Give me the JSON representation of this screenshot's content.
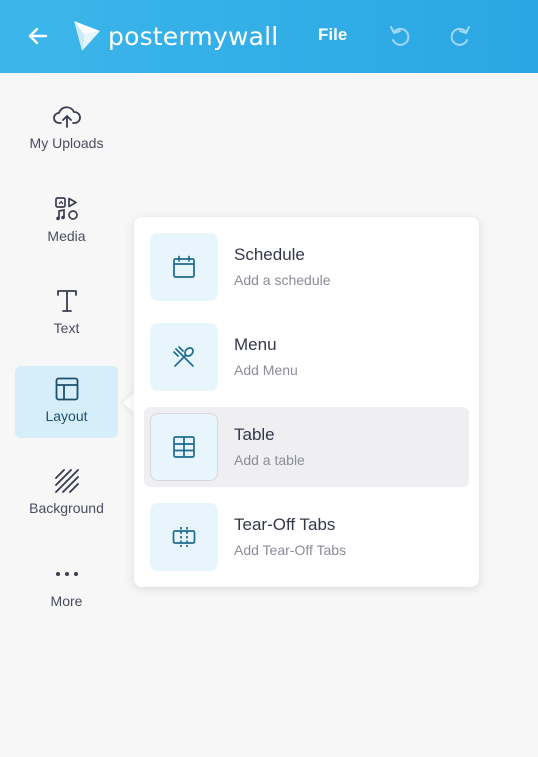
{
  "header": {
    "brand": "postermywall",
    "file_label": "File",
    "colors": {
      "bar": "#2aa6e4",
      "text": "#ffffff"
    }
  },
  "sidebar": {
    "items": [
      {
        "label": "My Uploads",
        "icon": "cloud-upload-icon"
      },
      {
        "label": "Media",
        "icon": "media-icon"
      },
      {
        "label": "Text",
        "icon": "text-icon"
      },
      {
        "label": "Layout",
        "icon": "layout-icon",
        "active": true
      },
      {
        "label": "Background",
        "icon": "background-pattern-icon"
      },
      {
        "label": "More",
        "icon": "more-dots-icon"
      }
    ]
  },
  "layout_menu": {
    "options": [
      {
        "title": "Schedule",
        "subtitle": "Add a schedule",
        "icon": "calendar-icon"
      },
      {
        "title": "Menu",
        "subtitle": "Add Menu",
        "icon": "fork-spoon-icon"
      },
      {
        "title": "Table",
        "subtitle": "Add a table",
        "icon": "table-grid-icon",
        "hovered": true
      },
      {
        "title": "Tear-Off Tabs",
        "subtitle": "Add Tear-Off Tabs",
        "icon": "tear-off-tabs-icon"
      }
    ],
    "colors": {
      "icon_bg": "#e9f5fc",
      "icon_stroke": "#1d6a93",
      "hover_bg": "#efeff2"
    }
  }
}
